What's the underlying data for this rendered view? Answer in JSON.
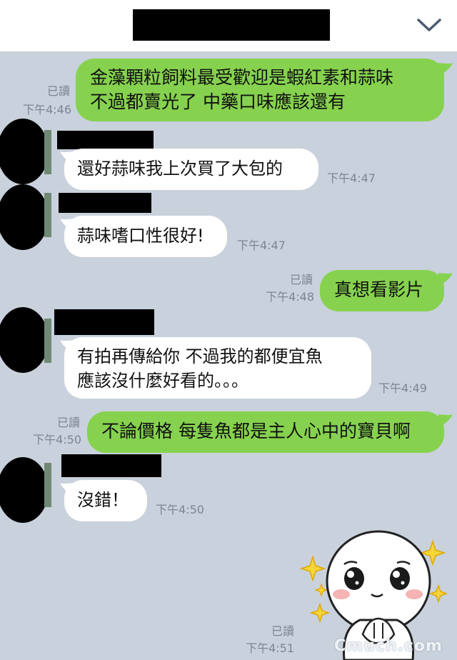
{
  "header": {
    "title_redacted": true
  },
  "messages": [
    {
      "side": "me",
      "lines": [
        "金藻顆粒飼料最受歡迎是蝦紅素和蒜味",
        "不過都賣光了  中藥口味應該還有"
      ],
      "read": "已讀",
      "time": "下午4:46"
    },
    {
      "side": "in",
      "lines": [
        "還好蒜味我上次買了大包的"
      ],
      "time": "下午4:47"
    },
    {
      "side": "in",
      "lines": [
        "蒜味嗜口性很好!"
      ],
      "time": "下午4:47"
    },
    {
      "side": "me",
      "lines": [
        "真想看影片"
      ],
      "read": "已讀",
      "time": "下午4:48"
    },
    {
      "side": "in",
      "lines": [
        "有拍再傳給你  不過我的都便宜魚",
        "應該沒什麼好看的。。。"
      ],
      "time": "下午4:49"
    },
    {
      "side": "me",
      "lines": [
        "不論價格  每隻魚都是主人心中的寶貝啊"
      ],
      "read": "已讀",
      "time": "下午4:50"
    },
    {
      "side": "in",
      "lines": [
        "沒錯！"
      ],
      "time": "下午4:50"
    },
    {
      "side": "me",
      "sticker": "cute-face-sticker",
      "read": "已讀",
      "time": "下午4:51"
    }
  ],
  "watermark": "Cmuch.com",
  "colors": {
    "background": "#c9d1dc",
    "my_bubble": "#86d24f",
    "their_bubble": "#ffffff",
    "meta_text": "#7b8593"
  }
}
